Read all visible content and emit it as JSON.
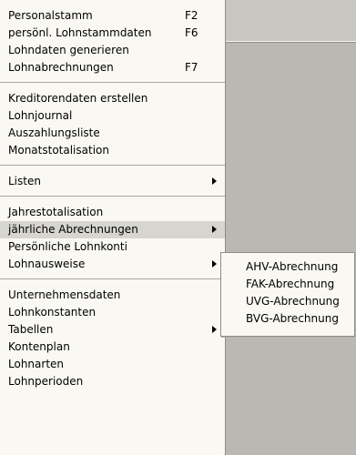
{
  "menu": {
    "items": [
      {
        "label": "Personalstamm",
        "shortcut": "F2"
      },
      {
        "label": "persönl. Lohnstammdaten",
        "shortcut": "F6"
      },
      {
        "label": "Lohndaten generieren",
        "shortcut": ""
      },
      {
        "label": "Lohnabrechnungen",
        "shortcut": "F7"
      },
      {
        "label": "Kreditorendaten erstellen",
        "shortcut": ""
      },
      {
        "label": "Lohnjournal",
        "shortcut": ""
      },
      {
        "label": "Auszahlungsliste",
        "shortcut": ""
      },
      {
        "label": "Monatstotalisation",
        "shortcut": ""
      },
      {
        "label": "Listen",
        "shortcut": ""
      },
      {
        "label": "Jahrestotalisation",
        "shortcut": ""
      },
      {
        "label": "jährliche Abrechnungen",
        "shortcut": ""
      },
      {
        "label": "Persönliche Lohnkonti",
        "shortcut": ""
      },
      {
        "label": "Lohnausweise",
        "shortcut": ""
      },
      {
        "label": "Unternehmensdaten",
        "shortcut": ""
      },
      {
        "label": "Lohnkonstanten",
        "shortcut": ""
      },
      {
        "label": "Tabellen",
        "shortcut": ""
      },
      {
        "label": "Kontenplan",
        "shortcut": ""
      },
      {
        "label": "Lohnarten",
        "shortcut": ""
      },
      {
        "label": "Lohnperioden",
        "shortcut": ""
      }
    ]
  },
  "submenu": {
    "items": [
      {
        "label": "AHV-Abrechnung"
      },
      {
        "label": "FAK-Abrechnung"
      },
      {
        "label": "UVG-Abrechnung"
      },
      {
        "label": "BVG-Abrechnung"
      }
    ]
  },
  "icons": {
    "submenu_arrow": "submenu-arrow-icon"
  },
  "colors": {
    "menu_background": "#f9f8f3",
    "active_item": "#d6d5d0",
    "background_panel": "#b9b8b3"
  }
}
